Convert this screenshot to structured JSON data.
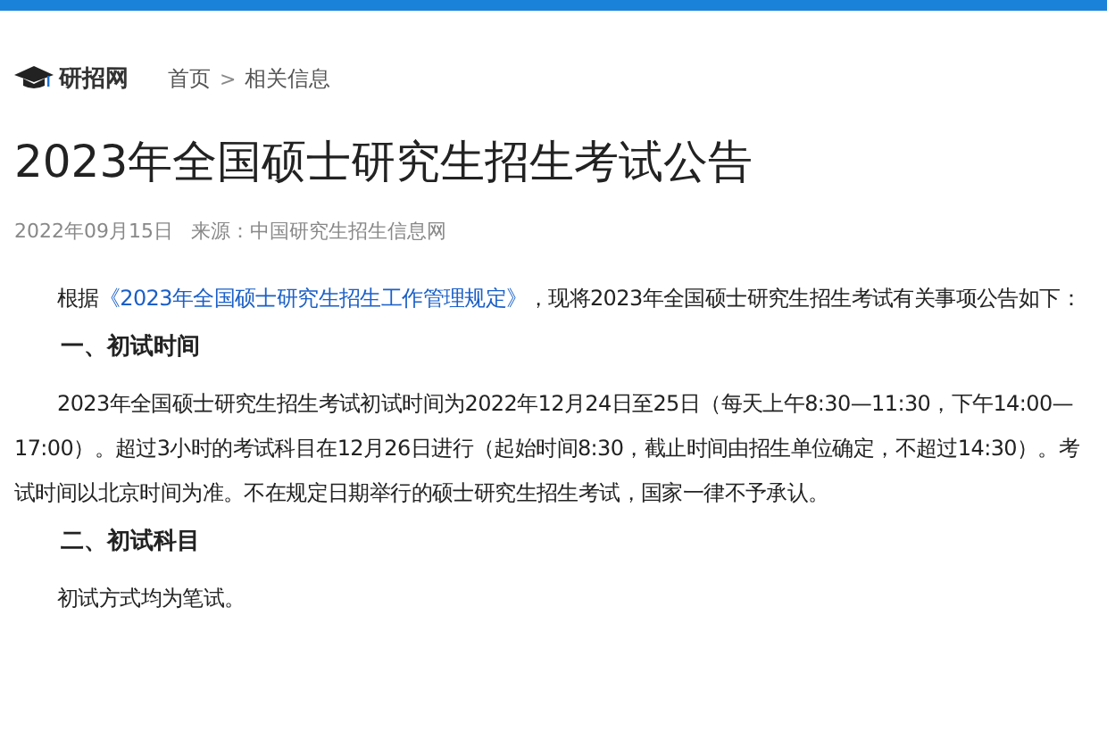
{
  "header": {
    "site_name": "研招网",
    "breadcrumb": [
      {
        "label": "首页"
      },
      {
        "label": "相关信息"
      }
    ],
    "separator": ">"
  },
  "title": "2023年全国硕士研究生招生考试公告",
  "meta": {
    "date": "2022年09月15日",
    "source": "来源：中国研究生招生信息网"
  },
  "body": [
    {
      "kind": "paragraph",
      "before": "根据",
      "link": "《2023年全国硕士研究生招生工作管理规定》",
      "after": "，现将2023年全国硕士研究生招生考试有关事项公告如下："
    },
    {
      "kind": "heading",
      "text": "一、初试时间"
    },
    {
      "kind": "paragraph",
      "before": "2023年全国硕士研究生招生考试初试时间为2022年12月24日至25日（每天上午8:30—11:30，下午14:00—17:00）。超过3小时的考试科目在12月26日进行（起始时间8:30，截止时间由招生单位确定，不超过14:30）。考试时间以北京时间为准。不在规定日期举行的硕士研究生招生考试，国家一律不予承认。"
    },
    {
      "kind": "heading",
      "text": "二、初试科目"
    },
    {
      "kind": "paragraph",
      "before": "初试方式均为笔试。"
    }
  ]
}
